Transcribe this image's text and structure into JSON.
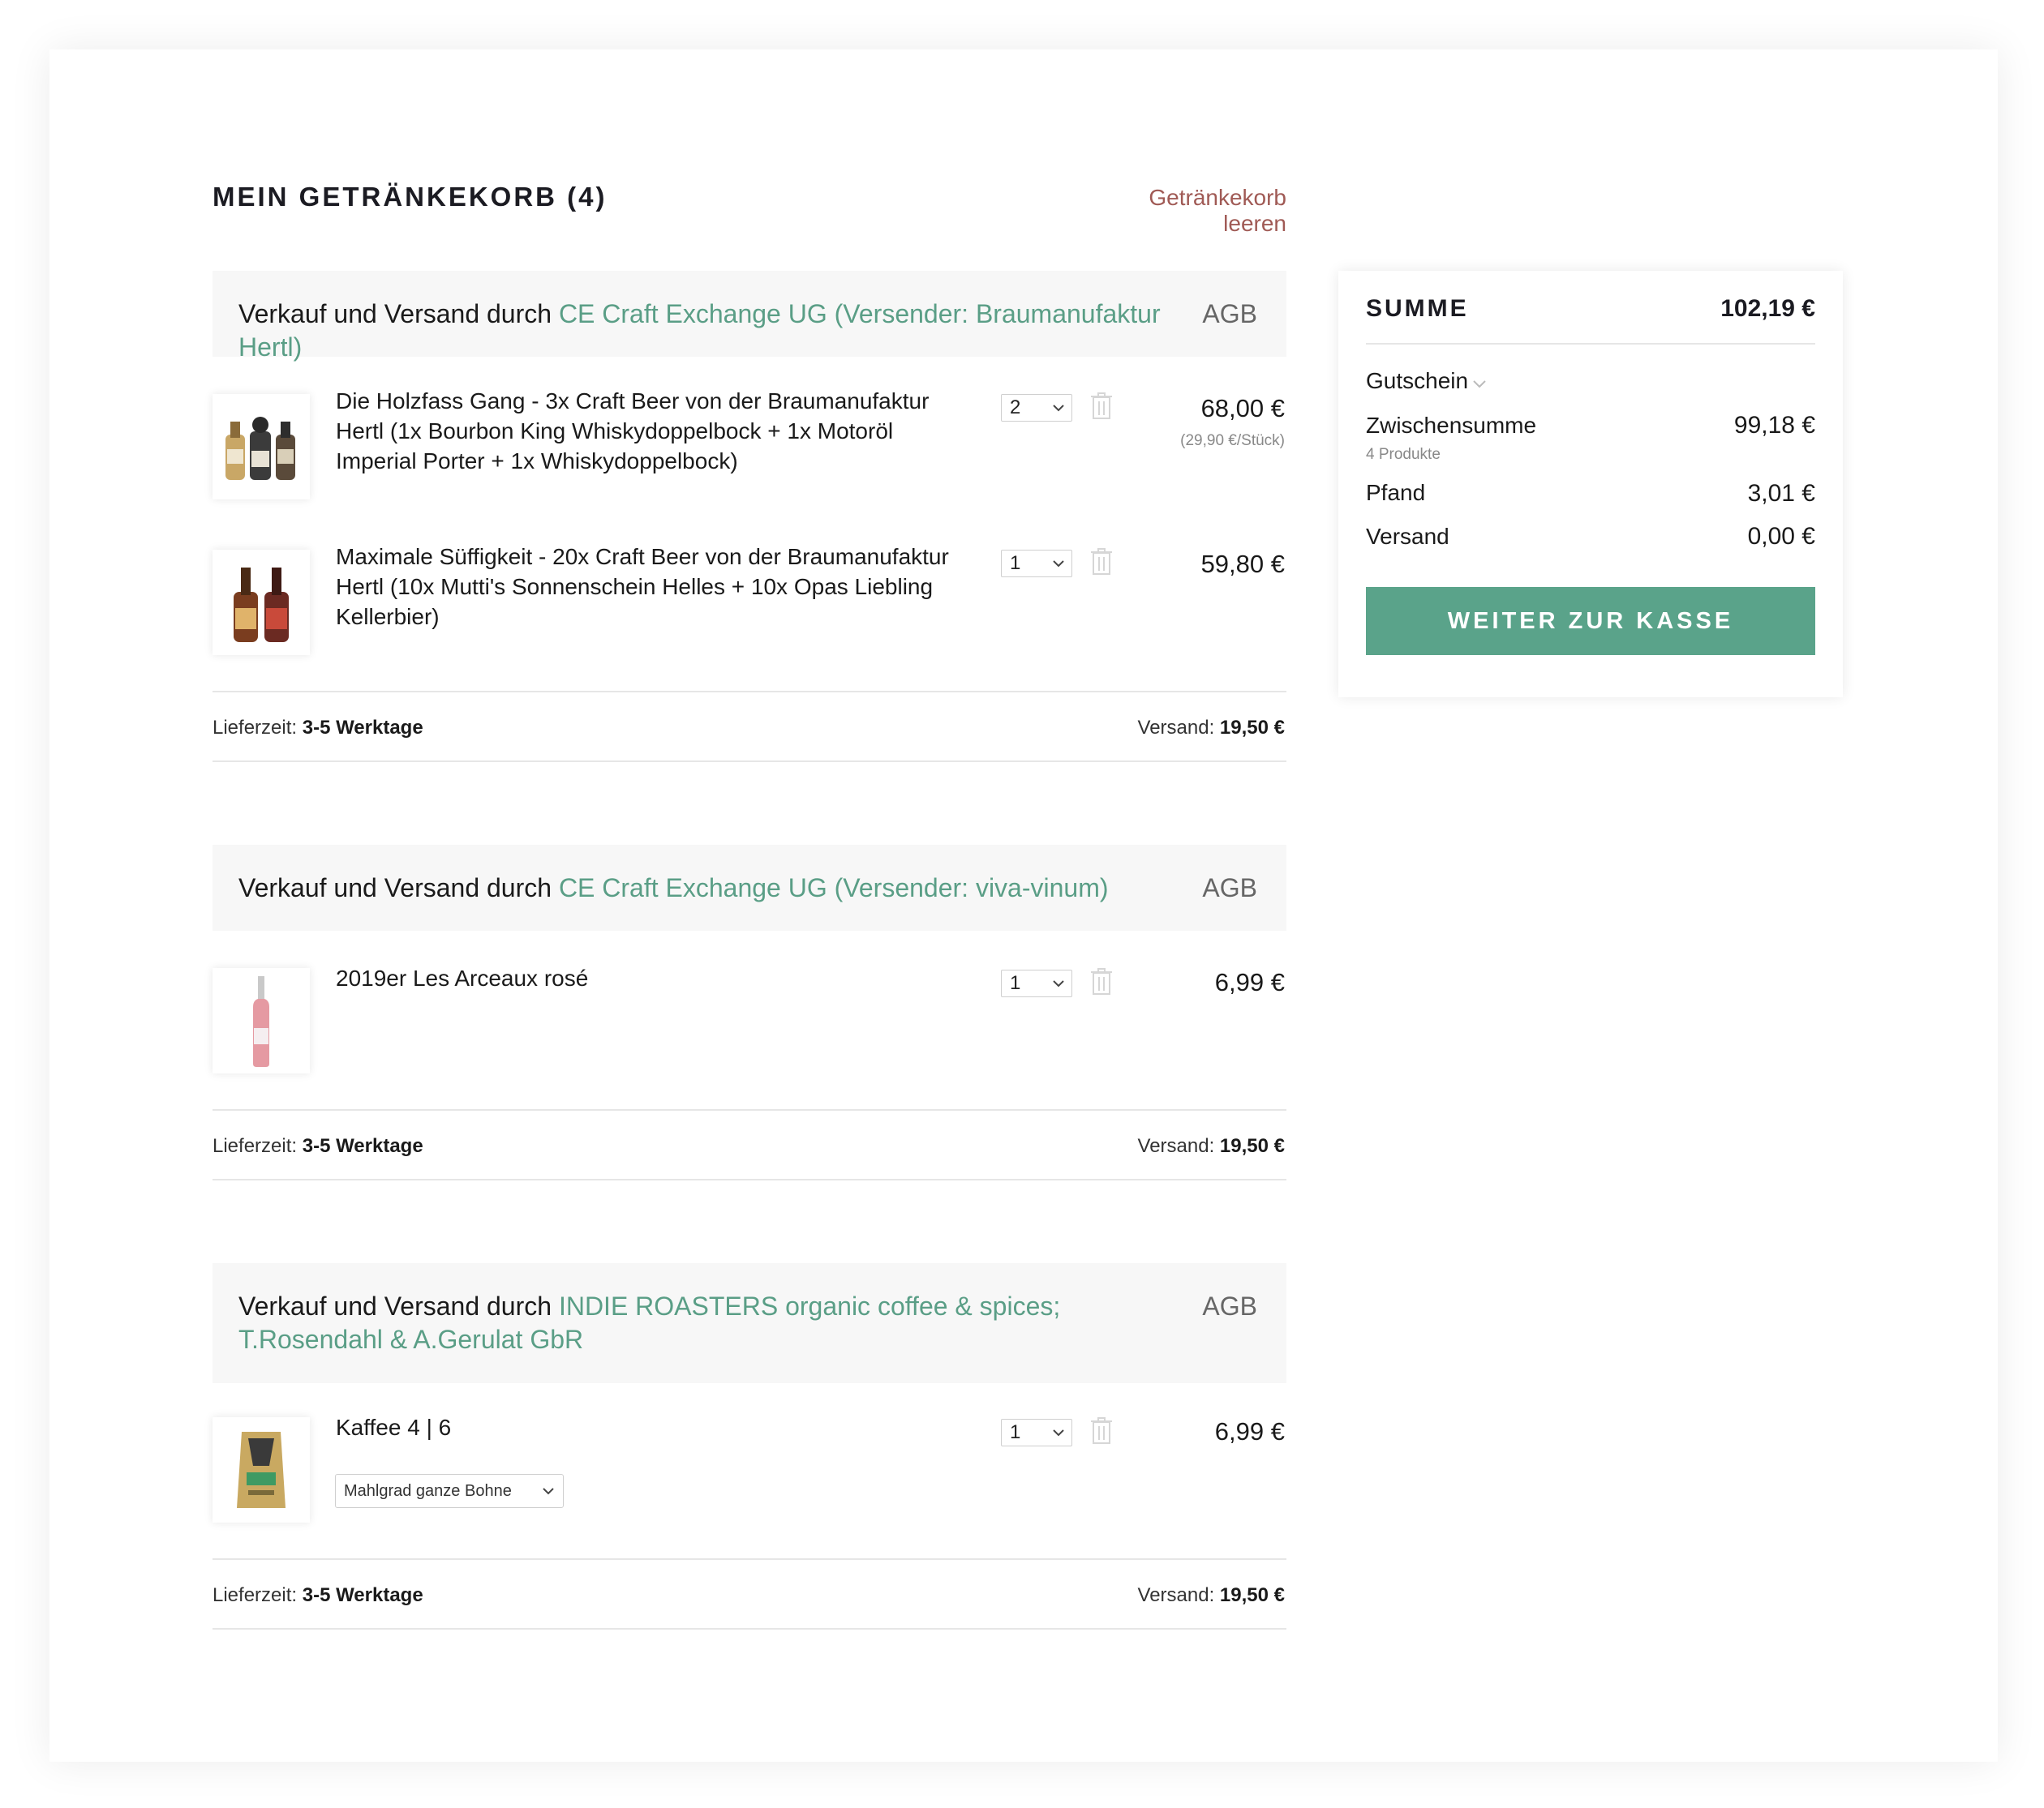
{
  "header": {
    "title": "MEIN GETRÄNKEKORB (4)",
    "clear_link": "Getränkekorb leeren"
  },
  "groups": [
    {
      "vendor_prefix": "Verkauf und Versand durch ",
      "vendor_name": "CE Craft Exchange UG (Versender: Braumanufaktur Hertl)",
      "agb": "AGB",
      "items": [
        {
          "title": "Die Holzfass Gang - 3x Craft Beer von der Braumanufaktur Hertl (1x Bourbon King Whiskydoppelbock + 1x Motoröl Imperial Porter + 1x Whiskydoppelbock)",
          "qty": "2",
          "price": "68,00 €",
          "unit_price": "(29,90 €/Stück)",
          "icon": "three-beer-bottles"
        },
        {
          "title": "Maximale Süffigkeit - 20x Craft Beer von der Braumanufaktur Hertl (10x Mutti's Sonnenschein Helles + 10x Opas Liebling Kellerbier)",
          "qty": "1",
          "price": "59,80 €",
          "icon": "two-beer-bottles"
        }
      ],
      "delivery_label": "Lieferzeit:",
      "delivery_value": "3-5 Werktage",
      "shipping_label": "Versand:",
      "shipping_value": "19,50 €"
    },
    {
      "vendor_prefix": "Verkauf und Versand durch ",
      "vendor_name": "CE Craft Exchange UG (Versender: viva-vinum)",
      "agb": "AGB",
      "items": [
        {
          "title": "2019er Les Arceaux rosé",
          "qty": "1",
          "price": "6,99 €",
          "icon": "rose-wine-bottle"
        }
      ],
      "delivery_label": "Lieferzeit:",
      "delivery_value": "3-5 Werktage",
      "shipping_label": "Versand:",
      "shipping_value": "19,50 €"
    },
    {
      "vendor_prefix": "Verkauf und Versand durch ",
      "vendor_name": "INDIE ROASTERS organic coffee & spices; T.Rosendahl & A.Gerulat GbR",
      "agb": "AGB",
      "items": [
        {
          "title": "Kaffee 4 | 6",
          "qty": "1",
          "price": "6,99 €",
          "variant": "Mahlgrad ganze Bohne",
          "icon": "coffee-bag"
        }
      ],
      "delivery_label": "Lieferzeit:",
      "delivery_value": "3-5 Werktage",
      "shipping_label": "Versand:",
      "shipping_value": "19,50 €"
    }
  ],
  "summary": {
    "title": "SUMME",
    "total": "102,19 €",
    "coupon_label": "Gutschein",
    "subtotal_label": "Zwischensumme",
    "subtotal_value": "99,18 €",
    "subtotal_sub": "4 Produkte",
    "deposit_label": "Pfand",
    "deposit_value": "3,01 €",
    "shipping_label": "Versand",
    "shipping_value": "0,00 €",
    "checkout_label": "WEITER ZUR KASSE"
  },
  "colors": {
    "accent_green": "#5aa38a",
    "vendor_link": "#5a9e86",
    "clear_link": "#a05a55"
  }
}
